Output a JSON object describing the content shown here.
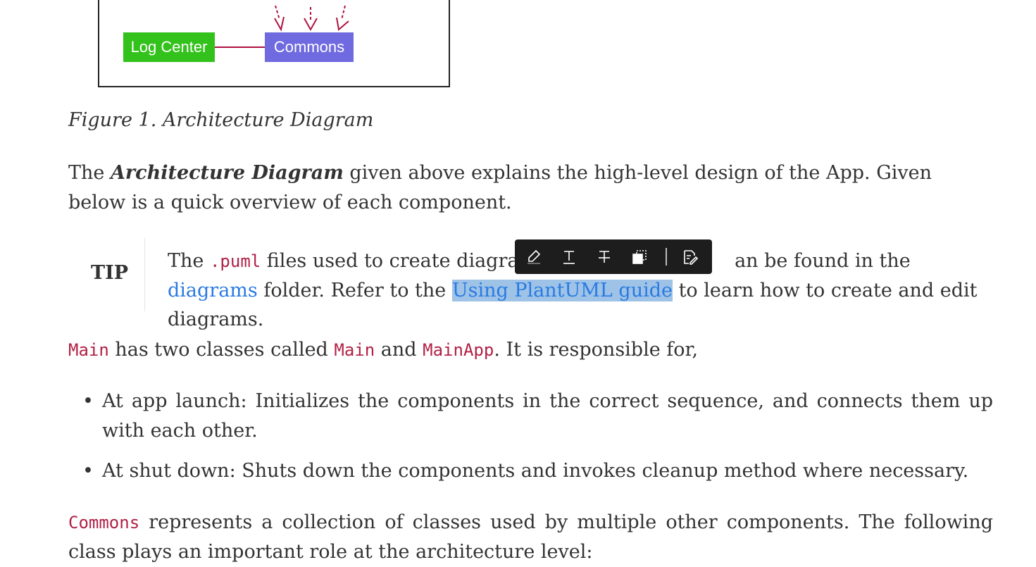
{
  "diagram": {
    "box_log_center": "Log Center",
    "box_commons": "Commons"
  },
  "caption": "Figure 1. Architecture Diagram",
  "para1": {
    "pre": "The ",
    "emph": "Architecture Diagram",
    "post": " given above explains the high-level design of the App. Given below is a quick overview of each component."
  },
  "tip": {
    "label": "TIP",
    "t1": "The ",
    "code": ".puml",
    "t2": " files used to create diagram",
    "t3": "an be found in the ",
    "link_diagrams": "diagrams",
    "t4": " folder. Refer to the ",
    "link_plantuml": "Using PlantUML guide",
    "t5": " to learn how to create and edit diagrams."
  },
  "toolbar": {
    "buttons": [
      "highlight-icon",
      "underline-icon",
      "strikethrough-icon",
      "copy-icon",
      "edit-icon"
    ]
  },
  "para2": {
    "code1": "Main",
    "t1": " has two classes called ",
    "code2": "Main",
    "t2": " and ",
    "code3": "MainApp",
    "t3": ". It is responsible for,"
  },
  "list": [
    "At app launch: Initializes the components in the correct sequence, and connects them up with each other.",
    "At shut down: Shuts down the components and invokes cleanup method where necessary."
  ],
  "para3": {
    "code": "Commons",
    "text": " represents a collection of classes used by multiple other components. The following class plays an important role at the architecture level:"
  },
  "colors": {
    "link": "#2a7ae2",
    "code": "#b12146",
    "highlight": "#9ec3e6",
    "log_center": "#33c11c",
    "commons": "#6f6ae0",
    "arrow": "#b01040"
  }
}
